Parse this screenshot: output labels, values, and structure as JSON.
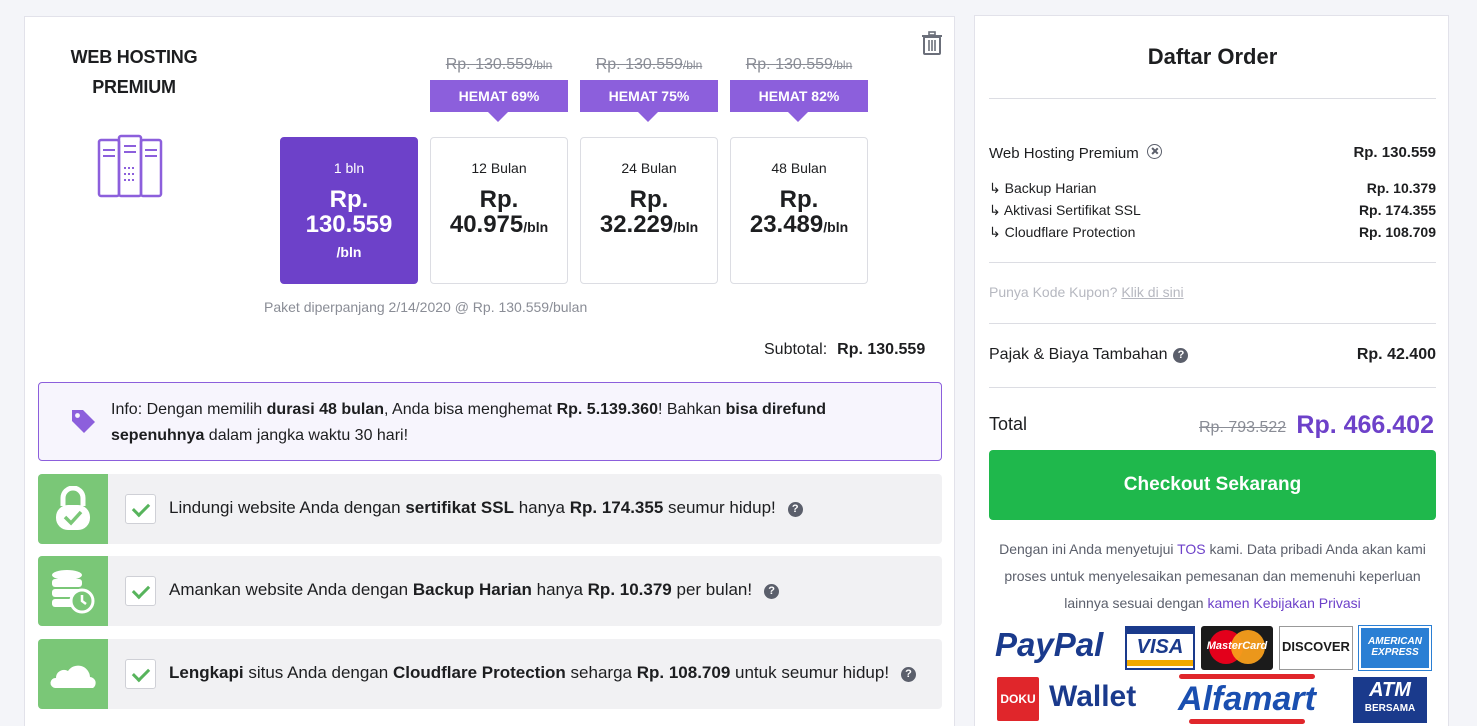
{
  "product": {
    "title_line1": "WEB HOSTING",
    "title_line2": "PREMIUM"
  },
  "plans": [
    {
      "period": "1 bln",
      "price_rp": "Rp.",
      "price": "130.559",
      "per": "/bln",
      "old_price": "",
      "save": "",
      "active": true
    },
    {
      "period": "12 Bulan",
      "price_rp": "Rp.",
      "price": "40.975",
      "per": "/bln",
      "old_price": "Rp. 130.559",
      "old_per": "/bln",
      "save": "HEMAT 69%"
    },
    {
      "period": "24 Bulan",
      "price_rp": "Rp.",
      "price": "32.229",
      "per": "/bln",
      "old_price": "Rp. 130.559",
      "old_per": "/bln",
      "save": "HEMAT 75%"
    },
    {
      "period": "48 Bulan",
      "price_rp": "Rp.",
      "price": "23.489",
      "per": "/bln",
      "old_price": "Rp. 130.559",
      "old_per": "/bln",
      "save": "HEMAT 82%"
    }
  ],
  "renewal_note": "Paket diperpanjang 2/14/2020 @ Rp. 130.559/bulan",
  "subtotal": {
    "label": "Subtotal:",
    "value": "Rp. 130.559"
  },
  "info": {
    "p1": "Info: Dengan memilih ",
    "b1": "durasi 48 bulan",
    "p2": ", Anda bisa menghemat ",
    "b2": "Rp. 5.139.360",
    "p3": "! Bahkan ",
    "b3": "bisa direfund sepenuhnya",
    "p4": " dalam jangka waktu 30 hari!"
  },
  "addons": [
    {
      "t1": "Lindungi website Anda dengan ",
      "b1": "sertifikat SSL",
      "t2": " hanya ",
      "b2": "Rp. 174.355",
      "t3": " seumur hidup!"
    },
    {
      "t1": "Amankan website Anda dengan ",
      "b1": "Backup Harian",
      "t2": " hanya ",
      "b2": "Rp. 10.379",
      "t3": " per bulan!"
    },
    {
      "b0": "Lengkapi",
      "t1": " situs Anda dengan ",
      "b1": "Cloudflare Protection",
      "t2": " seharga ",
      "b2": "Rp. 108.709",
      "t3": " untuk seumur hidup!"
    }
  ],
  "order": {
    "title": "Daftar Order",
    "item": {
      "label": "Web Hosting Premium",
      "value": "Rp. 130.559"
    },
    "subitems": [
      {
        "label": "↳ Backup Harian",
        "value": "Rp. 10.379"
      },
      {
        "label": "↳ Aktivasi Sertifikat SSL",
        "value": "Rp. 174.355"
      },
      {
        "label": "↳ Cloudflare Protection",
        "value": "Rp. 108.709"
      }
    ],
    "coupon_text": "Punya Kode Kupon? ",
    "coupon_link": "Klik di sini",
    "tax": {
      "label": "Pajak & Biaya Tambahan",
      "value": "Rp. 42.400"
    },
    "total": {
      "label": "Total",
      "old": "Rp. 793.522",
      "new": "Rp. 466.402"
    },
    "checkout": "Checkout Sekarang",
    "legal": {
      "t1": "Dengan ini Anda menyetujui ",
      "tos": "TOS",
      "t2": " kami. Data pribadi Anda akan kami proses untuk menyelesaikan pemesanan dan memenuhi keperluan lainnya sesuai dengan ",
      "privacy": "kamen Kebijakan Privasi"
    }
  },
  "payment": {
    "paypal": "PayPal",
    "visa": "VISA",
    "mastercard": "MasterCard",
    "discover": "DISCOVER",
    "amex_1": "AMERICAN",
    "amex_2": "EXPRESS",
    "doku": "DOKU",
    "wallet": "Wallet",
    "alfamart": "Alfamart",
    "atm_1": "ATM",
    "atm_2": "BERSAMA"
  },
  "colors": {
    "primary": "#6d41c9",
    "badge": "#8c5fdc",
    "checkout": "#1fb84c",
    "addon_icon": "#7ac777"
  }
}
